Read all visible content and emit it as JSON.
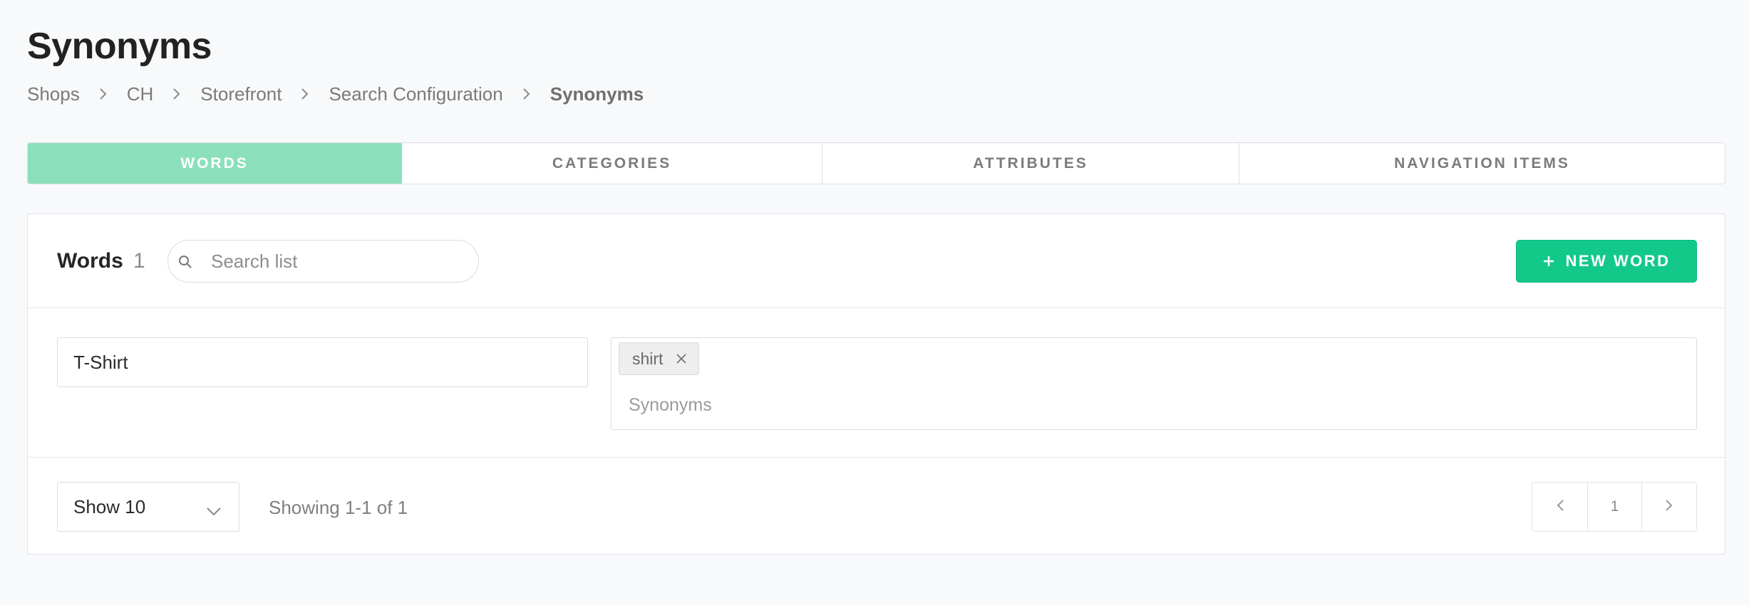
{
  "page": {
    "title": "Synonyms"
  },
  "breadcrumb": {
    "items": [
      "Shops",
      "CH",
      "Storefront",
      "Search Configuration",
      "Synonyms"
    ]
  },
  "tabs": [
    {
      "label": "WORDS",
      "active": true
    },
    {
      "label": "CATEGORIES",
      "active": false
    },
    {
      "label": "ATTRIBUTES",
      "active": false
    },
    {
      "label": "NAVIGATION ITEMS",
      "active": false
    }
  ],
  "list": {
    "title": "Words",
    "count": "1",
    "search_placeholder": "Search list",
    "new_button_label": "NEW WORD"
  },
  "rows": [
    {
      "word": "T-Shirt",
      "synonyms": [
        "shirt"
      ],
      "synonyms_placeholder": "Synonyms"
    }
  ],
  "footer": {
    "page_size_label": "Show 10",
    "showing_text": "Showing 1-1 of 1",
    "current_page": "1"
  },
  "colors": {
    "active_tab": "#8be0bb",
    "primary_button": "#12c98a",
    "background": "#f8f9fa"
  },
  "icons": [
    "chevron-right-icon",
    "search-icon",
    "plus-icon",
    "close-icon",
    "chevron-down-icon",
    "chevron-left-icon"
  ]
}
